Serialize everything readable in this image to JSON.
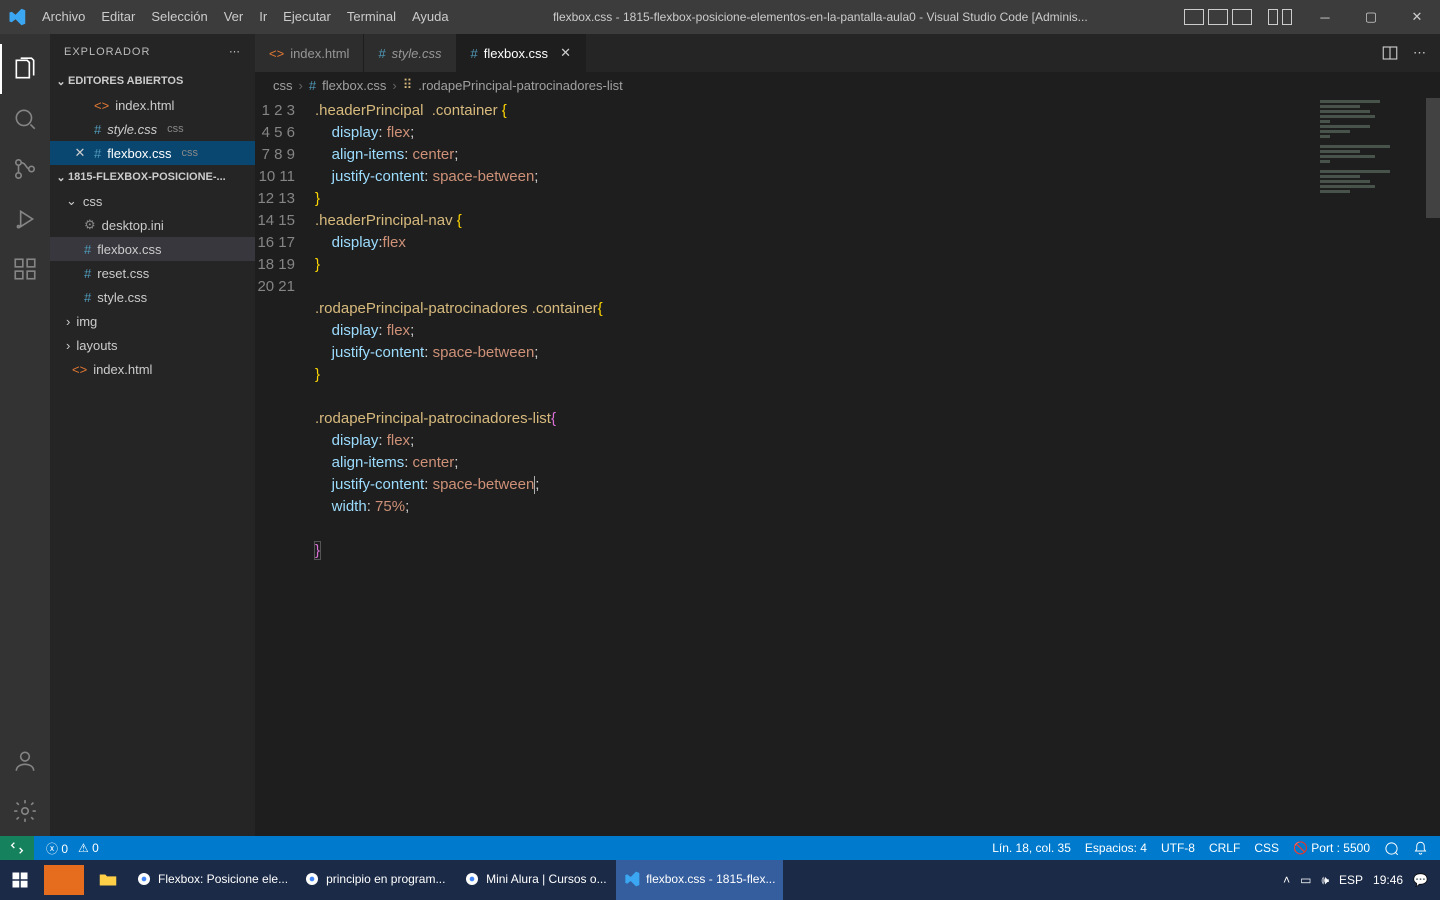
{
  "titlebar": {
    "menus": [
      "Archivo",
      "Editar",
      "Selección",
      "Ver",
      "Ir",
      "Ejecutar",
      "Terminal",
      "Ayuda"
    ],
    "title": "flexbox.css - 1815-flexbox-posicione-elementos-en-la-pantalla-aula0 - Visual Studio Code [Adminis..."
  },
  "sidebar": {
    "title": "EXPLORADOR",
    "open_editors_label": "EDITORES ABIERTOS",
    "open_editors": [
      {
        "name": "index.html",
        "ext": "",
        "type": "html"
      },
      {
        "name": "style.css",
        "ext": "css",
        "type": "css",
        "italic": true
      },
      {
        "name": "flexbox.css",
        "ext": "css",
        "type": "css",
        "active": true
      }
    ],
    "project_label": "1815-FLEXBOX-POSICIONE-...",
    "folder_css": "css",
    "files_css": [
      {
        "name": "desktop.ini",
        "type": "ini"
      },
      {
        "name": "flexbox.css",
        "type": "css",
        "sel": true
      },
      {
        "name": "reset.css",
        "type": "css"
      },
      {
        "name": "style.css",
        "type": "css"
      }
    ],
    "folder_img": "img",
    "folder_layouts": "layouts",
    "root_index": "index.html"
  },
  "tabs": [
    {
      "name": "index.html",
      "type": "html"
    },
    {
      "name": "style.css",
      "type": "css",
      "italic": true
    },
    {
      "name": "flexbox.css",
      "type": "css",
      "active": true
    }
  ],
  "breadcrumbs": {
    "p1": "css",
    "p2": "flexbox.css",
    "p3": ".rodapePrincipal-patrocinadores-list"
  },
  "code": {
    "lines": 21,
    "l1_a": ".headerPrincipal",
    "l1_b": ".container",
    "l1_c": "{",
    "l2_p": "display",
    "l2_v": "flex",
    "l3_p": "align-items",
    "l3_v": "center",
    "l4_p": "justify-content",
    "l4_v": "space-between",
    "l5": "}",
    "l6_a": ".headerPrincipal-nav",
    "l6_c": "{",
    "l7_p": "display",
    "l7_v": "flex",
    "l8": "}",
    "l10_a": ".rodapePrincipal-patrocinadores",
    "l10_b": ".container",
    "l10_c": "{",
    "l11_p": "display",
    "l11_v": "flex",
    "l12_p": "justify-content",
    "l12_v": "space-between",
    "l13": "}",
    "l15_a": ".rodapePrincipal-patrocinadores-list",
    "l15_c": "{",
    "l16_p": "display",
    "l16_v": "flex",
    "l17_p": "align-items",
    "l17_v": "center",
    "l18_p": "justify-content",
    "l18_v": "space-between",
    "l19_p": "width",
    "l19_v": "75%",
    "l21": "}"
  },
  "status": {
    "errors": "0",
    "warnings": "0",
    "pos": "Lín. 18, col. 35",
    "spaces": "Espacios: 4",
    "enc": "UTF-8",
    "eol": "CRLF",
    "lang": "CSS",
    "port": "Port : 5500"
  },
  "taskbar": {
    "items": [
      "Flexbox: Posicione ele...",
      "principio en program...",
      "Mini Alura | Cursos o...",
      "flexbox.css - 1815-flex..."
    ],
    "lang": "ESP",
    "time": "19:46"
  }
}
